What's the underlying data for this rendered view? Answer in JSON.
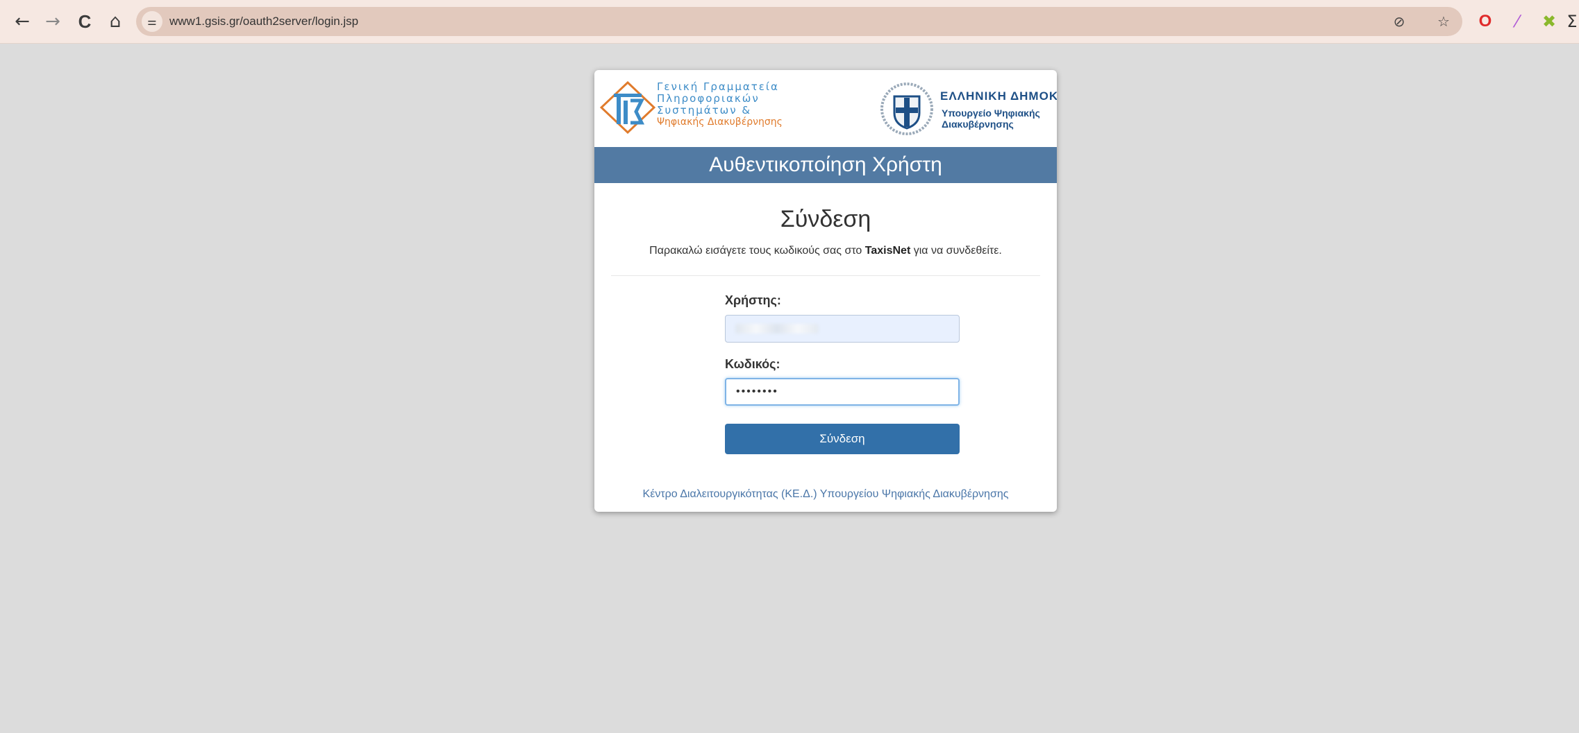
{
  "browser": {
    "back_icon": "←",
    "forward_icon": "→",
    "reload_icon": "C",
    "home_icon": "⌂",
    "site_info_icon": "⚌",
    "url": "www1.gsis.gr/oauth2server/login.jsp",
    "eye_off_icon": "⊘",
    "bookmark_icon": "☆",
    "extensions": [
      {
        "name": "opera-icon",
        "glyph": "O",
        "color": "#e02a2a"
      },
      {
        "name": "pen-icon",
        "glyph": "⁄",
        "color": "#b05ad6"
      },
      {
        "name": "puzzle-icon",
        "glyph": "✖",
        "color": "#8ab82c"
      },
      {
        "name": "more-icon",
        "glyph": "Σ",
        "color": "#333333"
      }
    ]
  },
  "logos": {
    "gsis_lines": [
      "Γενική Γραμματεία",
      "Πληροφοριακών",
      "Συστημάτων &",
      "Ψηφιακής Διακυβέρνησης"
    ],
    "gov_title": "ΕΛΛΗΝΙΚΗ ΔΗΜΟΚΡΑΤΙΑ",
    "gov_subtitle_1": "Υπουργείο Ψηφιακής",
    "gov_subtitle_2": "Διακυβέρνησης"
  },
  "card": {
    "banner": "Αυθεντικοποίηση Χρήστη",
    "heading": "Σύνδεση",
    "instructions_before": "Παρακαλώ εισάγετε τους κωδικούς σας στο ",
    "instructions_bold": "TaxisNet",
    "instructions_after": " για να συνδεθείτε.",
    "username_label": "Χρήστης:",
    "password_label": "Κωδικός:",
    "password_value": "••••••••",
    "submit_label": "Σύνδεση",
    "footer_link": "Κέντρο Διαλειτουργικότητας (ΚΕ.Δ.) Υπουργείου Ψηφιακής Διακυβέρνησης"
  },
  "colors": {
    "banner_bg": "#527aa3",
    "button_bg": "#3270a9",
    "link": "#4a76a8",
    "gov_blue": "#1d4f86",
    "gsis_blue": "#3d8cc7",
    "gsis_orange": "#e07b2c"
  }
}
